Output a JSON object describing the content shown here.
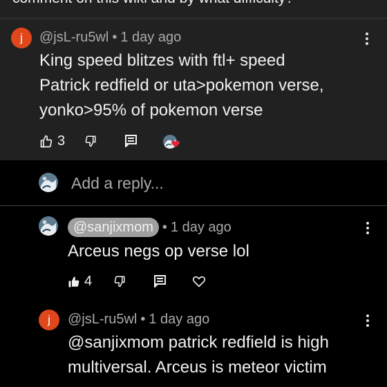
{
  "top_cut_text": "comment on  this wiki and by what difficulty? ",
  "comments": [
    {
      "author": "@jsL-ru5wl",
      "avatar_letter": "j",
      "time": "1 day ago",
      "lines": [
        "King speed blitzes with ftl+ speed",
        "Patrick redfield or uta>pokemon verse,",
        "yonko>95% of pokemon verse"
      ],
      "likes": "3"
    },
    {
      "author": "@sanjixmom",
      "time": "1 day ago",
      "lines": [
        "Arceus negs op verse lol"
      ],
      "likes": "4"
    },
    {
      "author": "@jsL-ru5wl",
      "avatar_letter": "j",
      "time": "1 day ago",
      "lines": [
        "@sanjixmom  patrick redfield is high",
        "multiversal. Arceus is meteor victim"
      ]
    }
  ],
  "reply": {
    "placeholder": "Add a reply..."
  },
  "separator": "•",
  "icons": {
    "like": "thumbs-up-icon",
    "like_filled": "thumbs-up-filled-icon",
    "dislike": "thumbs-down-icon",
    "reply": "reply-icon",
    "heart": "heart-icon",
    "more": "more-vert-icon"
  },
  "colors": {
    "avatar_j": "#e0471c",
    "heart_badge": "#e0263a"
  }
}
